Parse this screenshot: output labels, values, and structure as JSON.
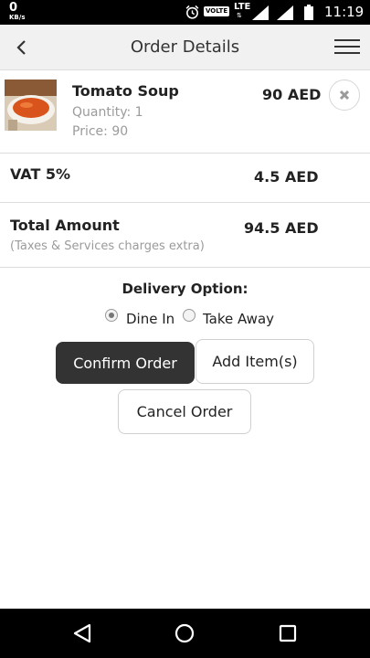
{
  "status_bar": {
    "speed_value": "0",
    "speed_unit": "KB/s",
    "volte": "VOLTE",
    "network": "LTE",
    "time": "11:19",
    "icons": [
      "alarm-icon",
      "signal-icon",
      "battery-icon"
    ]
  },
  "header": {
    "title": "Order Details",
    "back_icon": "chevron-left-icon",
    "menu_icon": "hamburger-menu-icon"
  },
  "order_item": {
    "name": "Tomato Soup",
    "quantity": "Quantity: 1",
    "price": "Price: 90",
    "total": "90 AED",
    "remove_icon": "close-icon"
  },
  "vat": {
    "label": "VAT 5%",
    "value": "4.5 AED"
  },
  "total": {
    "label": "Total Amount",
    "note": "(Taxes & Services charges extra)",
    "value": "94.5 AED"
  },
  "delivery": {
    "label": "Delivery Option:",
    "options": [
      {
        "label": "Dine In",
        "selected": true
      },
      {
        "label": "Take Away",
        "selected": false
      }
    ]
  },
  "actions": {
    "confirm": "Confirm Order",
    "add": "Add Item(s)",
    "cancel": "Cancel Order"
  },
  "colors": {
    "header_bg": "#f1f1f1",
    "primary_button": "#333333",
    "muted_text": "#9b9b9b"
  }
}
